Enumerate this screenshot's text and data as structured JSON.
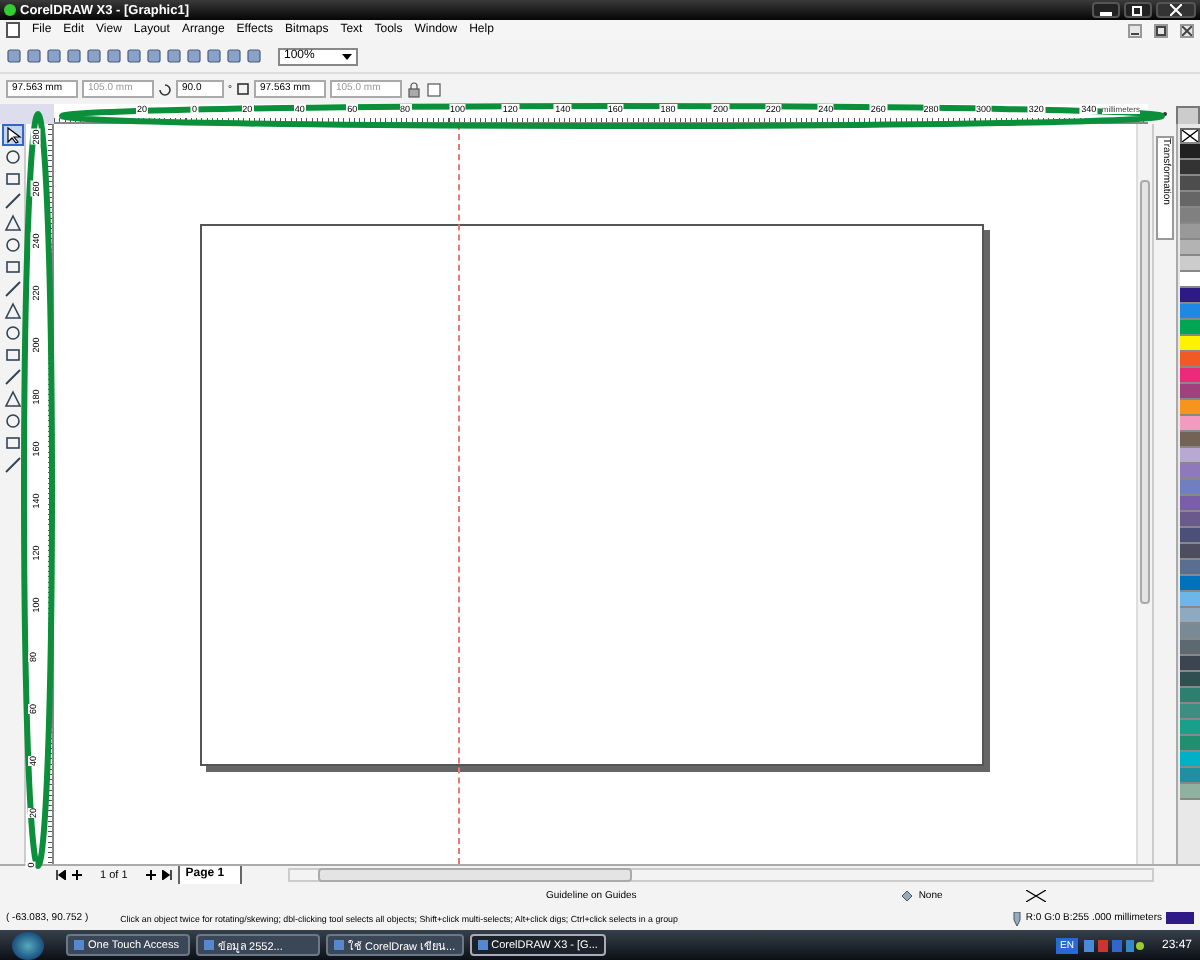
{
  "window": {
    "title": "CorelDRAW X3 - [Graphic1]"
  },
  "menu": [
    "File",
    "Edit",
    "View",
    "Layout",
    "Arrange",
    "Effects",
    "Bitmaps",
    "Text",
    "Tools",
    "Window",
    "Help"
  ],
  "toolbar": {
    "zoom": "100%"
  },
  "property_bar": {
    "x": "97.563 mm",
    "y": "105.0 mm",
    "rotation": "90.0",
    "degree": "°",
    "width": "97.563 mm",
    "height": "105.0 mm"
  },
  "horizontal_ruler": {
    "labels": [
      "20",
      "0",
      "20",
      "40",
      "60",
      "80",
      "100",
      "120",
      "140",
      "160",
      "180",
      "200",
      "220",
      "240",
      "260",
      "280",
      "300",
      "320",
      "340"
    ],
    "unit": "millimeters"
  },
  "vertical_ruler": {
    "labels": [
      "280",
      "260",
      "240",
      "220",
      "200",
      "180",
      "160",
      "140",
      "120",
      "100",
      "80",
      "60",
      "40",
      "20",
      "0"
    ]
  },
  "docker_tab": "Transformation",
  "palette": [
    {
      "kind": "none"
    },
    {
      "kind": "swatch",
      "color": "#202020"
    },
    {
      "kind": "swatch",
      "color": "#333333"
    },
    {
      "kind": "swatch",
      "color": "#4d4d4d"
    },
    {
      "kind": "swatch",
      "color": "#666666"
    },
    {
      "kind": "swatch",
      "color": "#808080"
    },
    {
      "kind": "swatch",
      "color": "#999999"
    },
    {
      "kind": "swatch",
      "color": "#b3b3b3"
    },
    {
      "kind": "swatch",
      "color": "#cccccc"
    },
    {
      "kind": "swatch",
      "color": "#ffffff"
    },
    {
      "kind": "swatch",
      "color": "#2e1a87"
    },
    {
      "kind": "swatch",
      "color": "#1e88e5"
    },
    {
      "kind": "swatch",
      "color": "#00a651"
    },
    {
      "kind": "swatch",
      "color": "#fff200"
    },
    {
      "kind": "swatch",
      "color": "#f15a24"
    },
    {
      "kind": "swatch",
      "color": "#ec2a7a"
    },
    {
      "kind": "swatch",
      "color": "#a0417d"
    },
    {
      "kind": "swatch",
      "color": "#f7941d"
    },
    {
      "kind": "swatch",
      "color": "#f49ac1"
    },
    {
      "kind": "swatch",
      "color": "#736357"
    },
    {
      "kind": "swatch",
      "color": "#b8a9d3"
    },
    {
      "kind": "swatch",
      "color": "#8f79b8"
    },
    {
      "kind": "swatch",
      "color": "#6f7fc0"
    },
    {
      "kind": "swatch",
      "color": "#7a5fa8"
    },
    {
      "kind": "swatch",
      "color": "#6a5a8c"
    },
    {
      "kind": "swatch",
      "color": "#4a5078"
    },
    {
      "kind": "swatch",
      "color": "#4d4d60"
    },
    {
      "kind": "swatch",
      "color": "#5a6f8f"
    },
    {
      "kind": "swatch",
      "color": "#0072bc"
    },
    {
      "kind": "swatch",
      "color": "#6ab7e8"
    },
    {
      "kind": "swatch",
      "color": "#8fa9c0"
    },
    {
      "kind": "swatch",
      "color": "#7a8a95"
    },
    {
      "kind": "swatch",
      "color": "#5d6970"
    },
    {
      "kind": "swatch",
      "color": "#3a4550"
    },
    {
      "kind": "swatch",
      "color": "#2f4f50"
    },
    {
      "kind": "swatch",
      "color": "#2d7f70"
    },
    {
      "kind": "swatch",
      "color": "#3a8f80"
    },
    {
      "kind": "swatch",
      "color": "#1a9f8a"
    },
    {
      "kind": "swatch",
      "color": "#1f8f6f"
    },
    {
      "kind": "swatch",
      "color": "#00b0c8"
    },
    {
      "kind": "swatch",
      "color": "#2090a0"
    },
    {
      "kind": "swatch",
      "color": "#90b0a0"
    }
  ],
  "page_nav": {
    "counter": "1 of 1",
    "tab": "Page 1"
  },
  "status_bar": {
    "guideline": "Guideline on Guides",
    "coordinates": "( -63.083, 90.752 )",
    "hint": "Click an object twice for rotating/skewing; dbl-clicking tool selects all objects; Shift+click multi-selects; Alt+click digs; Ctrl+click selects in a group",
    "fill": "None",
    "outline": "R:0 G:0 B:255 .000 millimeters"
  },
  "taskbar": {
    "items": [
      {
        "label": "One Touch Access",
        "selected": false
      },
      {
        "label": "ข้อมูล 2552...",
        "selected": false
      },
      {
        "label": "ใช้ CorelDraw เขียน...",
        "selected": false
      },
      {
        "label": "CorelDRAW X3 - [G...",
        "selected": true
      }
    ],
    "language": "EN",
    "clock": "23:47"
  }
}
